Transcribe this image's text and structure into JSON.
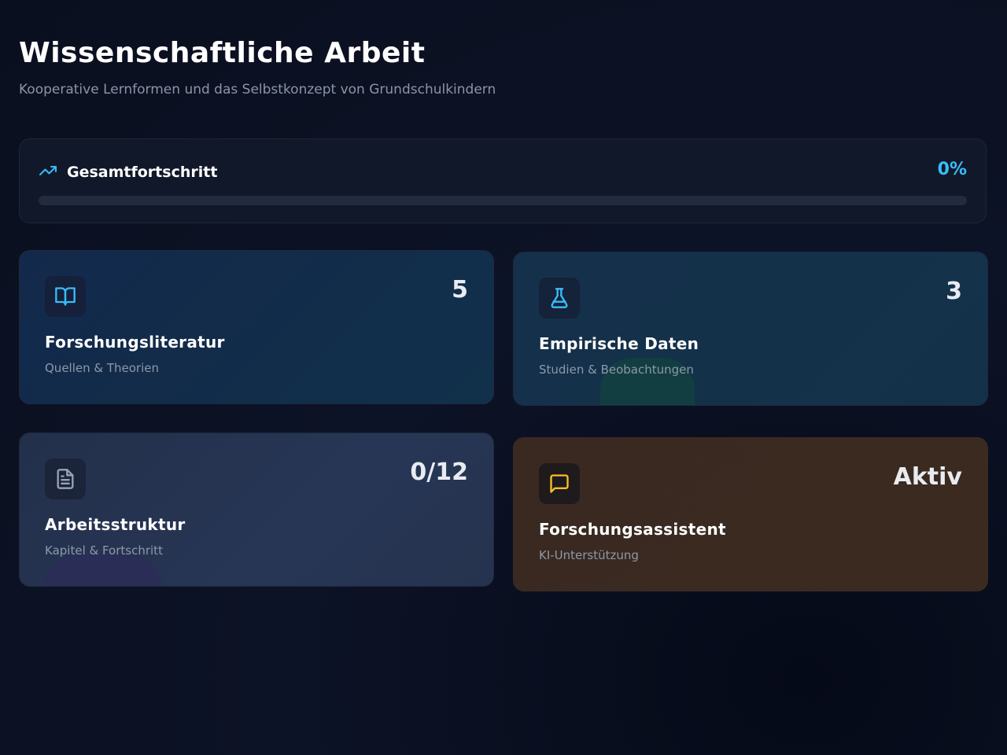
{
  "header": {
    "title": "Wissenschaftliche Arbeit",
    "subtitle": "Kooperative Lernformen und das Selbstkonzept von Grundschulkindern"
  },
  "progress": {
    "label": "Gesamtfortschritt",
    "percent_text": "0%",
    "value": 0,
    "icon": "trending-up-icon",
    "accent": "#38bdf8"
  },
  "cards": [
    {
      "title": "Forschungsliteratur",
      "subtitle": "Quellen & Theorien",
      "count": "5",
      "icon": "book-open-icon",
      "color": "#38bdf8"
    },
    {
      "title": "Empirische Daten",
      "subtitle": "Studien & Beobachtungen",
      "count": "3",
      "icon": "flask-icon",
      "color": "#38bdf8"
    },
    {
      "title": "Arbeitsstruktur",
      "subtitle": "Kapitel & Fortschritt",
      "count": "0/12",
      "icon": "file-text-icon",
      "color": "#94a3b8"
    },
    {
      "title": "Forschungsassistent",
      "subtitle": "KI-Unterstützung",
      "count": "Aktiv",
      "icon": "message-square-icon",
      "color": "#fbbf24"
    }
  ]
}
